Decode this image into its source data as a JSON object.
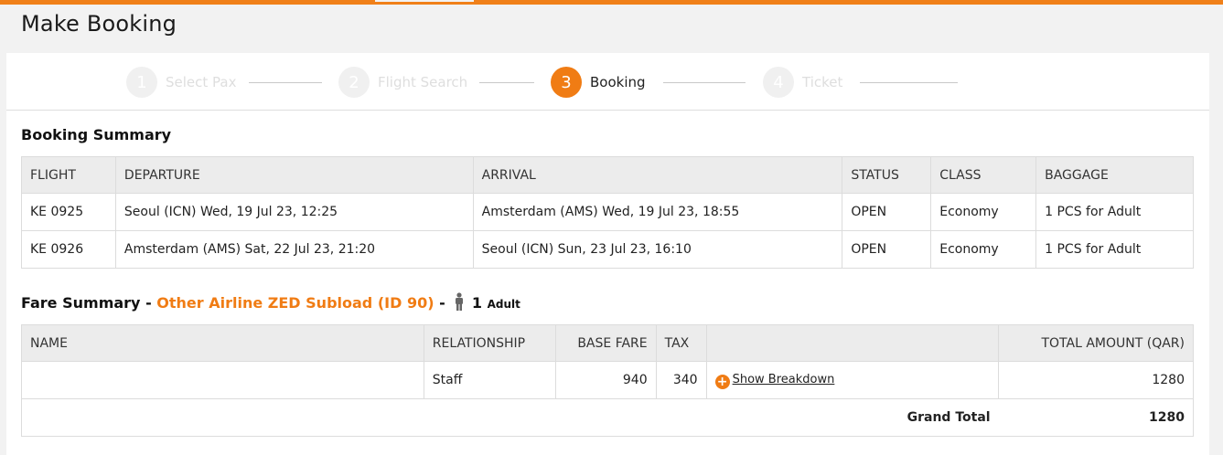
{
  "page": {
    "title": "Make Booking"
  },
  "stepper": {
    "steps": [
      {
        "number": "1",
        "label": "Select Pax",
        "active": false
      },
      {
        "number": "2",
        "label": "Flight Search",
        "active": false
      },
      {
        "number": "3",
        "label": "Booking",
        "active": true
      },
      {
        "number": "4",
        "label": "Ticket",
        "active": false
      }
    ]
  },
  "booking_summary": {
    "title": "Booking Summary",
    "columns": [
      "FLIGHT",
      "DEPARTURE",
      "ARRIVAL",
      "STATUS",
      "CLASS",
      "BAGGAGE"
    ],
    "rows": [
      {
        "flight": "KE 0925",
        "departure": "Seoul (ICN) Wed, 19 Jul 23, 12:25",
        "arrival": "Amsterdam (AMS) Wed, 19 Jul 23, 18:55",
        "status": "OPEN",
        "class": "Economy",
        "baggage": "1 PCS for Adult"
      },
      {
        "flight": "KE 0926",
        "departure": "Amsterdam (AMS) Sat, 22 Jul 23, 21:20",
        "arrival": "Seoul (ICN) Sun, 23 Jul 23, 16:10",
        "status": "OPEN",
        "class": "Economy",
        "baggage": "1 PCS for Adult"
      }
    ]
  },
  "fare_summary": {
    "title": "Fare Summary",
    "separator": "-",
    "airline": "Other Airline ZED Subload (ID 90)",
    "separator2": "-",
    "pax_count": "1",
    "pax_type": "Adult",
    "columns": {
      "name": "NAME",
      "relationship": "RELATIONSHIP",
      "base_fare": "BASE FARE",
      "tax": "TAX",
      "total": "TOTAL AMOUNT (QAR)"
    },
    "row": {
      "name": "",
      "relationship": "Staff",
      "base_fare": "940",
      "tax": "340",
      "breakdown_label": "Show Breakdown",
      "total": "1280"
    },
    "grand_total_label": "Grand Total",
    "grand_total": "1280"
  },
  "colors": {
    "accent": "#f07c14",
    "header_bg": "#ececec"
  },
  "icons": {
    "person": "person-icon",
    "plus": "plus-circle-icon"
  }
}
